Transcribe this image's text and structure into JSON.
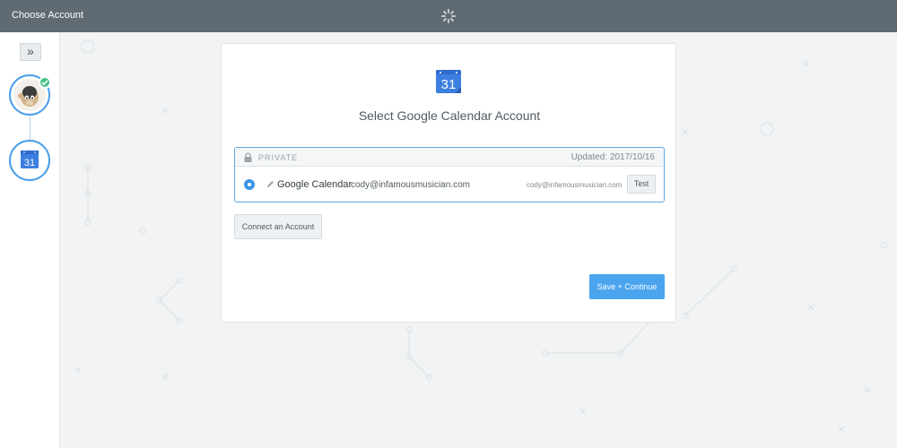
{
  "topbar": {
    "title": "Choose Account",
    "spinner_icon": "gear-spinner-icon"
  },
  "sidebar": {
    "expand_icon": "double-chevron-right-icon",
    "expand_glyph": "»",
    "steps": [
      {
        "app": "MailChimp",
        "icon": "mailchimp-logo-icon",
        "status": "complete"
      },
      {
        "app": "Google Calendar",
        "icon": "google-calendar-icon",
        "status": "active"
      }
    ]
  },
  "card": {
    "icon": "google-calendar-icon",
    "icon_day": "31",
    "title": "Select Google Calendar Account",
    "account_group": {
      "lock_icon": "lock-icon",
      "label": "PRIVATE",
      "updated_label": "Updated:",
      "updated_date": "2017/10/16"
    },
    "account": {
      "selected": true,
      "edit_icon": "pencil-icon",
      "name": "Google Calendar",
      "email": "cody@infamousmusician.com",
      "email_right": "cody@infamousmusician.com",
      "test_label": "Test"
    },
    "connect_label": "Connect an Account",
    "save_label": "Save + Continue"
  },
  "colors": {
    "topbar": "#5f6a72",
    "accent": "#4ba4ee",
    "success": "#44c283",
    "background": "#f1f3f4"
  }
}
